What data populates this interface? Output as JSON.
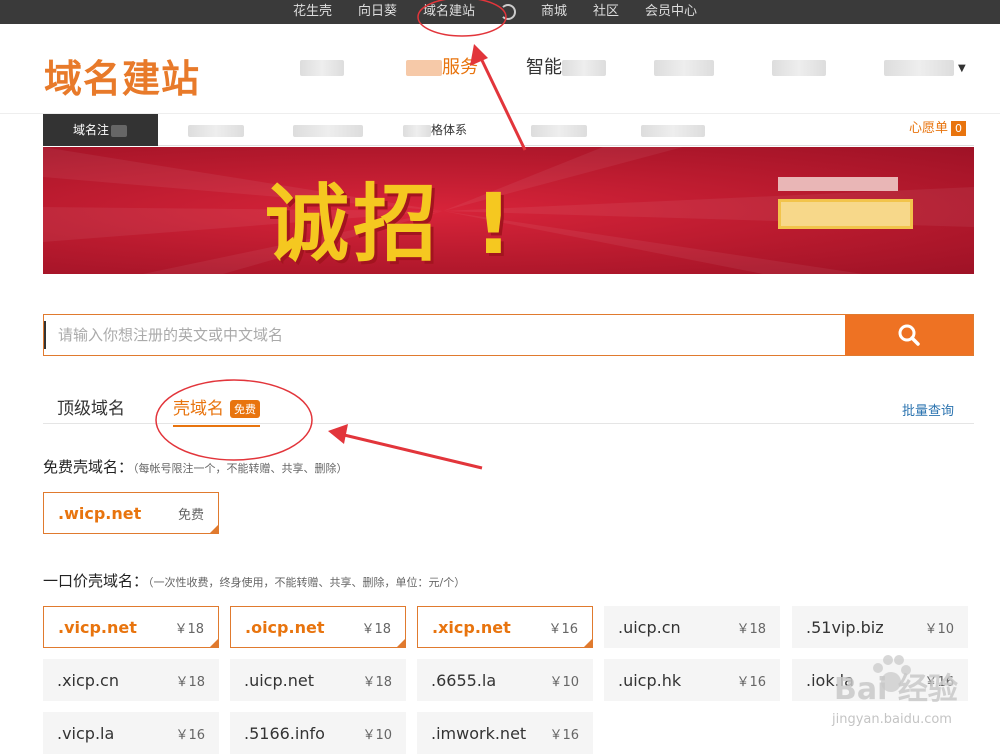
{
  "topbar": {
    "links": [
      "花生壳",
      "向日葵",
      "域名建站",
      "商城",
      "社区",
      "会员中心"
    ]
  },
  "header": {
    "logo": "域名建站",
    "nav": [
      "服务",
      "智能"
    ]
  },
  "subnav": {
    "tabs": [
      "域名注",
      "格体系"
    ],
    "wishlist": "心愿单",
    "wishlist_count": "0"
  },
  "banner": {
    "headline": "诚招         !"
  },
  "search": {
    "placeholder": "请输入你想注册的英文或中文域名"
  },
  "tabs": {
    "top_level": "顶级域名",
    "shell": "壳域名",
    "free_badge": "免费",
    "batch": "批量查询"
  },
  "free_section": {
    "title": "免费壳域名：",
    "note": "（每帐号限注一个，不能转赠、共享、删除）",
    "items": [
      {
        "name": ".wicp.net",
        "price": "免费"
      }
    ]
  },
  "paid_section": {
    "title": "一口价壳域名：",
    "note": "（一次性收费，终身使用，不能转赠、共享、删除，单位：元/个）",
    "items": [
      {
        "name": ".vicp.net",
        "price": "￥18"
      },
      {
        "name": ".oicp.net",
        "price": "￥18"
      },
      {
        "name": ".xicp.net",
        "price": "￥16"
      },
      {
        "name": ".uicp.cn",
        "price": "￥18"
      },
      {
        "name": ".51vip.biz",
        "price": "￥10"
      },
      {
        "name": ".xicp.cn",
        "price": "￥18"
      },
      {
        "name": ".uicp.net",
        "price": "￥18"
      },
      {
        "name": ".6655.la",
        "price": "￥10"
      },
      {
        "name": ".uicp.hk",
        "price": "￥16"
      },
      {
        "name": ".iok.la",
        "price": "￥16"
      },
      {
        "name": ".vicp.la",
        "price": "￥16"
      },
      {
        "name": ".5166.info",
        "price": "￥10"
      },
      {
        "name": ".imwork.net",
        "price": "￥16"
      }
    ]
  },
  "watermark": {
    "brand": "Bai 经验",
    "url": "jingyan.baidu.com"
  },
  "colors": {
    "accent": "#e8740e",
    "topbar": "#3a3a3a",
    "banner": "#c01f34",
    "link": "#2c74b0",
    "annotation": "#e2353b"
  }
}
